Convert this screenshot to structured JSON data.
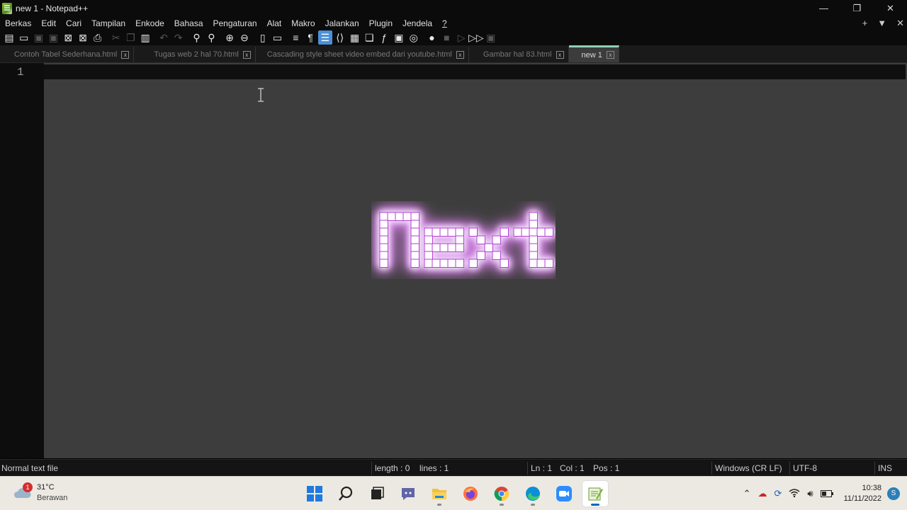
{
  "window": {
    "title": "new 1 - Notepad++",
    "controls": [
      "—",
      "❐",
      "✕"
    ]
  },
  "menu": {
    "items": [
      "Berkas",
      "Edit",
      "Cari",
      "Tampilan",
      "Enkode",
      "Bahasa",
      "Pengaturan",
      "Alat",
      "Makro",
      "Jalankan",
      "Plugin",
      "Jendela",
      "?"
    ],
    "right": [
      "+",
      "▼",
      "✕"
    ]
  },
  "toolbar": {
    "icons": [
      "new-file-icon",
      "open-file-icon",
      "save-icon",
      "save-all-icon",
      "close-icon",
      "close-all-icon",
      "print-icon",
      "cut-icon",
      "copy-icon",
      "paste-icon",
      "undo-icon",
      "redo-icon",
      "find-icon",
      "replace-icon",
      "zoom-in-icon",
      "zoom-out-icon",
      "sync-vertical-icon",
      "sync-horizontal-icon",
      "word-wrap-icon",
      "show-all-chars-icon",
      "indent-guide-icon",
      "xml-tag-icon",
      "doc-map-icon",
      "doc-list-icon",
      "function-list-icon",
      "folder-workspace-icon",
      "monitoring-icon",
      "record-macro-icon",
      "stop-macro-icon",
      "play-macro-icon",
      "run-macro-multiple-icon",
      "save-macro-icon"
    ]
  },
  "tabs": [
    {
      "label": "Contoh Tabel Sederhana.html",
      "active": false
    },
    {
      "label": "Tugas web 2 hal 70.html",
      "active": false
    },
    {
      "label": "Cascading style sheet video embed dari youtube.html",
      "active": false
    },
    {
      "label": "Gambar hal  83.html",
      "active": false
    },
    {
      "label": "new 1",
      "active": true
    }
  ],
  "tab_close_glyph": "x",
  "editor": {
    "line_numbers": [
      "1"
    ],
    "overlay_text": "Next",
    "overlay_color": "#b43cd6"
  },
  "status": {
    "file_type": "Normal text file",
    "length": "length : 0",
    "lines": "lines : 1",
    "ln": "Ln : 1",
    "col": "Col : 1",
    "pos": "Pos : 1",
    "eol": "Windows (CR LF)",
    "encoding": "UTF-8",
    "mode": "INS"
  },
  "taskbar": {
    "weather": {
      "temp": "31°C",
      "condition": "Berawan",
      "badge": "1"
    },
    "apps": [
      "windows-start-icon",
      "search-icon",
      "task-view-icon",
      "chat-icon",
      "file-explorer-icon",
      "firefox-icon",
      "chrome-icon",
      "edge-icon",
      "zoom-icon",
      "notepadpp-icon"
    ],
    "tray": {
      "time": "10:38",
      "date": "11/11/2022",
      "user_initial": "S"
    }
  }
}
